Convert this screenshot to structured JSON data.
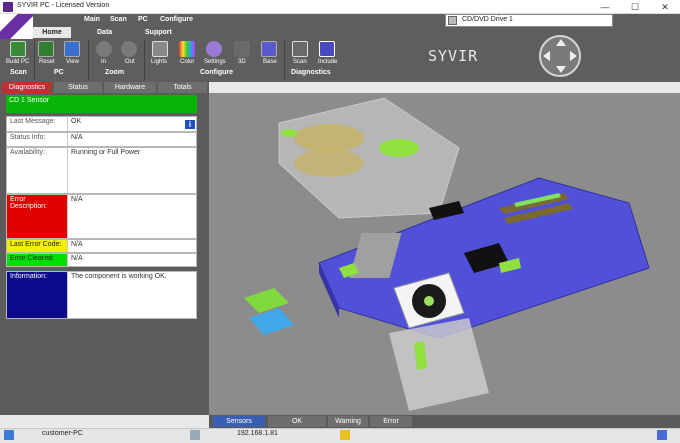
{
  "window": {
    "title": "SYVIR PC - Licensed Version",
    "min_symbol": "—",
    "max_symbol": "☐",
    "close_symbol": "✕"
  },
  "menu": {
    "top": [
      "Main",
      "Scan",
      "PC",
      "Configure"
    ],
    "second": [
      "Data",
      "Support"
    ],
    "home_tab": "Home"
  },
  "device_selector": {
    "value": "CD/DVD Drive 1"
  },
  "toolbar": {
    "buttons": [
      "Build PC",
      "Reset",
      "View",
      "In",
      "Out",
      "Lights",
      "Color",
      "Settings",
      "3D",
      "Base",
      "Scan",
      "Include"
    ],
    "groups": [
      "Scan",
      "PC",
      "Zoom",
      "Configure",
      "Diagnostics"
    ]
  },
  "brand": {
    "wordmark": "SYVIR"
  },
  "subtabs": [
    "Diagnostics",
    "Status",
    "Hardware",
    "Totals"
  ],
  "sensor": {
    "header": "CD 1 Sensor",
    "rows": [
      {
        "label": "Last Message:",
        "value": "OK"
      },
      {
        "label": "Status Info:",
        "value": "N/A"
      },
      {
        "label": "Availability:",
        "value": "Running or Full Power"
      },
      {
        "label": "Error Description:",
        "value": "N/A"
      },
      {
        "label": "Last Error Code:",
        "value": "N/A"
      },
      {
        "label": "Error Cleared:",
        "value": "N/A"
      },
      {
        "label": "Information:",
        "value": "The component is working OK."
      }
    ],
    "info_button": "i"
  },
  "bottom_tabs": [
    "Sensors",
    "OK",
    "Warning",
    "Error"
  ],
  "taskbar": {
    "computer_name": "customer-PC",
    "ip": "192.168.1.81"
  },
  "colors": {
    "ok_green": "#07b407",
    "error_red": "#e00000",
    "code_yellow": "#f0f000",
    "cleared_green": "#00e000",
    "info_blue": "#0a0a8a",
    "board_purple": "#5050d8"
  }
}
